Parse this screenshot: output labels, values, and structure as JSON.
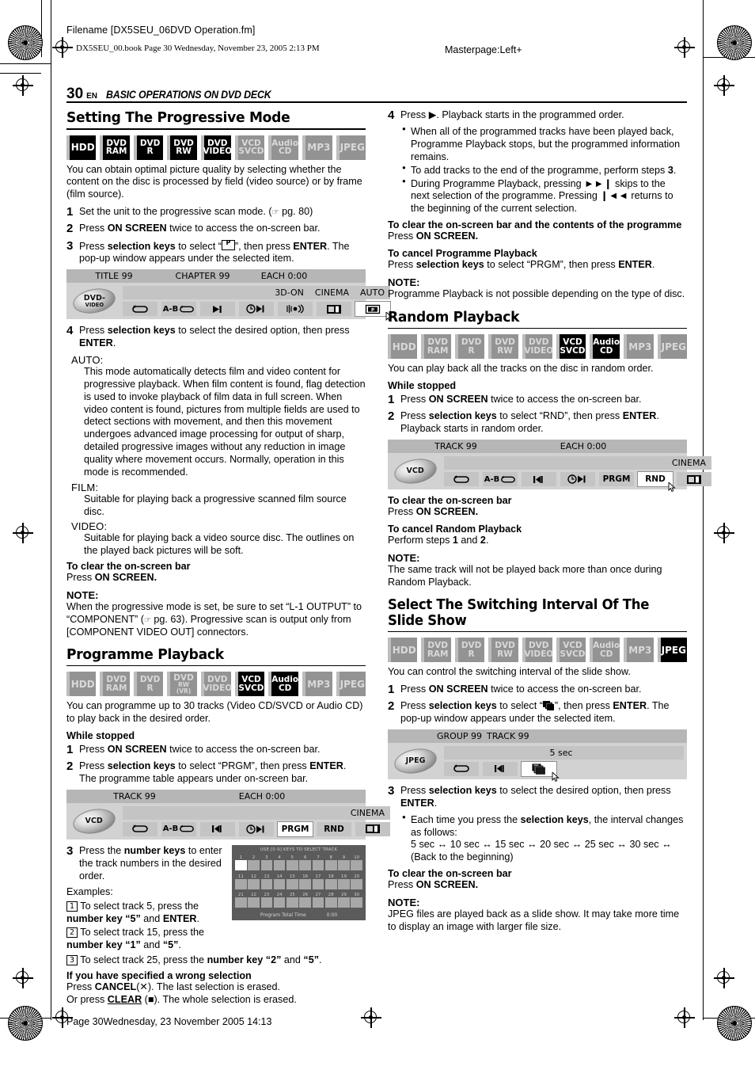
{
  "header": {
    "filename": "Filename [DX5SEU_06DVD Operation.fm]",
    "bookline": "DX5SEU_00.book  Page 30  Wednesday, November 23, 2005  2:13 PM",
    "masterpage": "Masterpage:Left+"
  },
  "page": {
    "number": "30",
    "lang": "EN",
    "chapter_title": "BASIC OPERATIONS ON DVD DECK",
    "footer": "Page 30Wednesday, 23 November 2005  14:13"
  },
  "badge_labels": {
    "hdd": "HDD",
    "dvd": "DVD",
    "ram": "RAM",
    "r": "R",
    "rw": "RW",
    "rw_vr": "RW (VR)",
    "video": "VIDEO",
    "vcd": "VCD",
    "svcd": "SVCD",
    "audio": "Audio",
    "cd": "CD",
    "mp3": "MP3",
    "jpeg": "JPEG"
  },
  "sections": {
    "progressive": {
      "heading": "Setting The Progressive Mode",
      "badge_states": [
        "on",
        "on",
        "on",
        "on",
        "on",
        "off",
        "off",
        "off",
        "off"
      ],
      "intro": "You can obtain optimal picture quality by selecting whether the content on the disc is processed by field (video source) or by frame (film source).",
      "step1_num": "1",
      "step1": "Set the unit to the progressive scan mode. (",
      "step1_pg": " pg. 80)",
      "step2_num": "2",
      "step2": "Press ON SCREEN twice to access the on-screen bar.",
      "step3_num": "3",
      "step3_a": "Press selection keys to select “",
      "step3_b": "”, then press ENTER. The pop-up window appears under the selected item.",
      "step4_num": "4",
      "step4": "Press selection keys to select the desired option, then press ENTER.",
      "auto_label": "AUTO:",
      "auto_body": "This mode automatically detects film and video content for progressive playback. When film content is found, flag detection is used to invoke playback of film data in full screen. When video content is found, pictures from multiple fields are used to detect sections with movement, and then this movement undergoes advanced image processing for output of sharp, detailed progressive images without any reduction in image quality where movement occurs. Normally, operation in this mode is recommended.",
      "film_label": "FILM:",
      "film_body": "Suitable for playing back a progressive scanned film source disc.",
      "video_label": "VIDEO:",
      "video_body": "Suitable for playing back a video source disc. The outlines on the played back pictures will be soft.",
      "clear_head": "To clear the on-screen bar",
      "clear_body": "Press ON SCREEN.",
      "note_head": "NOTE:",
      "note_body": "When the progressive mode is set, be sure to set “L-1 OUTPUT” to “COMPONENT” (",
      "note_body2": " pg. 63). Progressive scan is output only from [COMPONENT VIDEO OUT] connectors."
    },
    "progressive_osb": {
      "disc": "DVD-",
      "disc_sub": "VIDEO",
      "head": [
        "TITLE 99",
        "CHAPTER 99",
        "EACH 0:00"
      ],
      "status": [
        "3D-ON",
        "CINEMA",
        "AUTO"
      ],
      "buttons": [
        "repeat",
        "ab-repeat",
        "skip",
        "time-skip",
        "sound",
        "picture-mode",
        "progressive"
      ],
      "selected_index": 6
    },
    "programme": {
      "heading": "Programme Playback",
      "badge_states": [
        "off",
        "off",
        "off",
        "off",
        "off",
        "on",
        "on",
        "off",
        "off"
      ],
      "intro": "You can programme up to 30 tracks (Video CD/SVCD or Audio CD) to play back in the desired order.",
      "while_stopped": "While stopped",
      "step1_num": "1",
      "step1": "Press ON SCREEN twice to access the on-screen bar.",
      "step2_num": "2",
      "step2": "Press selection keys to select “PRGM”, then press ENTER. The programme table appears under on-screen bar.",
      "step3_num": "3",
      "step3": "Press the number keys to enter the track numbers in the desired order.",
      "examples": "Examples:",
      "ex1_num": "1",
      "ex1": "To select track 5, press the number key “5” and ENTER.",
      "ex2_num": "2",
      "ex2": "To select track 15, press the number key “1” and “5”.",
      "ex3_num": "3",
      "ex3": "To select track 25, press the number key “2” and “5”.",
      "wrong_head": "If you have specified a wrong selection",
      "wrong_1": "Press CANCEL(✕). The last selection is erased.",
      "wrong_2": "Or press CLEAR (■). The whole selection is erased."
    },
    "programme_osb": {
      "disc": "VCD",
      "head": [
        "TRACK 99",
        "EACH 0:00"
      ],
      "status": [
        "CINEMA"
      ],
      "buttons": [
        "repeat",
        "ab-repeat",
        "skip",
        "time-skip",
        "PRGM",
        "RND",
        "picture-mode"
      ],
      "selected_index": 4
    },
    "programme_table": {
      "title": "USE [0-9] KEYS TO SELECT TRACK",
      "rows": [
        [
          "1",
          "2",
          "3",
          "4",
          "5",
          "6",
          "7",
          "8",
          "9",
          "10"
        ],
        [
          "11",
          "12",
          "13",
          "14",
          "15",
          "16",
          "17",
          "18",
          "19",
          "20"
        ],
        [
          "21",
          "22",
          "23",
          "24",
          "25",
          "26",
          "27",
          "28",
          "29",
          "30"
        ]
      ],
      "foot_label": "Program Total Time",
      "foot_value": "0:00"
    },
    "programme_right": {
      "step4_num": "4",
      "step4": "Press ▶. Playback starts in the programmed order.",
      "bullets": [
        "When all of the programmed tracks have been played back, Programme Playback stops, but the programmed information remains.",
        "To add tracks to the end of the programme, perform steps 3.",
        "During Programme Playback, pressing ►►❙ skips to the next selection of the programme. Pressing ❙◄◄ returns to the beginning of the current selection."
      ],
      "clear_head": "To clear the on-screen bar and the contents of the programme",
      "clear_body": "Press ON SCREEN.",
      "cancel_head": "To cancel Programme Playback",
      "cancel_body": "Press selection keys to select “PRGM”, then press ENTER.",
      "note_head": "NOTE:",
      "note_body": "Programme Playback is not possible depending on the type of disc."
    },
    "random": {
      "heading": "Random Playback",
      "badge_states": [
        "off",
        "off",
        "off",
        "off",
        "off",
        "on",
        "on",
        "off",
        "off"
      ],
      "intro": "You can play back all the tracks on the disc in random order.",
      "while_stopped": "While stopped",
      "step1_num": "1",
      "step1": "Press ON SCREEN twice to access the on-screen bar.",
      "step2_num": "2",
      "step2": "Press selection keys to select “RND”, then press ENTER. Playback starts in random order.",
      "clear_head": "To clear the on-screen bar",
      "clear_body": "Press ON SCREEN.",
      "cancel_head": "To cancel Random Playback",
      "cancel_body": "Perform steps 1 and 2.",
      "note_head": "NOTE:",
      "note_body": "The same track will not be played back more than once during Random Playback."
    },
    "random_osb": {
      "disc": "VCD",
      "head": [
        "TRACK 99",
        "EACH 0:00"
      ],
      "status": [
        "CINEMA"
      ],
      "buttons": [
        "repeat",
        "ab-repeat",
        "skip",
        "time-skip",
        "PRGM",
        "RND",
        "picture-mode"
      ],
      "selected_index": 5
    },
    "slideshow": {
      "heading": "Select The Switching Interval Of The Slide Show",
      "badge_states": [
        "off",
        "off",
        "off",
        "off",
        "off",
        "off",
        "off",
        "off",
        "on"
      ],
      "intro": "You can control the switching interval of the slide show.",
      "step1_num": "1",
      "step1": "Press ON SCREEN twice to access the on-screen bar.",
      "step2_num": "2",
      "step2_a": "Press selection keys to select “",
      "step2_b": "”, then press ENTER. The pop-up window appears under the selected item.",
      "step3_num": "3",
      "step3": "Press selection keys to select the desired option, then press ENTER.",
      "bullet_a": "Each time you press the selection keys, the interval changes as follows:",
      "bullet_b": "5 sec ↔ 10 sec ↔ 15 sec ↔ 20 sec ↔ 25 sec ↔ 30 sec ↔ (Back to the beginning)",
      "clear_head": "To clear the on-screen bar",
      "clear_body": "Press ON SCREEN.",
      "note_head": "NOTE:",
      "note_body": "JPEG files are played back as a slide show. It may take more time to display an image with larger file size."
    },
    "slideshow_osb": {
      "disc": "JPEG",
      "head": [
        "GROUP 99",
        "TRACK 99"
      ],
      "interval": "5 sec",
      "buttons": [
        "repeat",
        "skip",
        "slide-interval"
      ],
      "selected_index": 2
    }
  }
}
